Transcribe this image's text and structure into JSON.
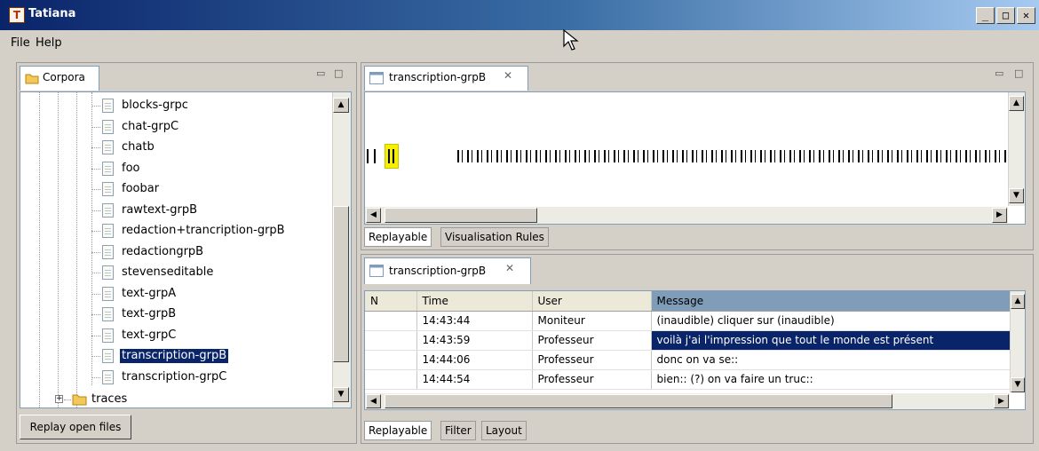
{
  "window": {
    "title": "Tatiana",
    "app_icon": "T",
    "controls": [
      "_",
      "□",
      "✕"
    ]
  },
  "menu": [
    "File",
    "Help"
  ],
  "corpora": {
    "tab_label": "Corpora",
    "items": [
      {
        "label": "blocks-grpc"
      },
      {
        "label": "chat-grpC"
      },
      {
        "label": "chatb"
      },
      {
        "label": "foo"
      },
      {
        "label": "foobar"
      },
      {
        "label": "rawtext-grpB"
      },
      {
        "label": "redaction+trancription-grpB"
      },
      {
        "label": "redactiongrpB"
      },
      {
        "label": "stevenseditable"
      },
      {
        "label": "text-grpA"
      },
      {
        "label": "text-grpB"
      },
      {
        "label": "text-grpC"
      },
      {
        "label": "transcription-grpB",
        "selected": true
      },
      {
        "label": "transcription-grpC"
      }
    ],
    "folder": {
      "expander": "+",
      "label": "traces"
    },
    "replay_button": "Replay open files"
  },
  "timeline_panel": {
    "tab_label": "transcription-grpB",
    "tabs": [
      "Replayable",
      "Visualisation Rules"
    ]
  },
  "table_panel": {
    "tab_label": "transcription-grpB",
    "columns": [
      "N",
      "Time",
      "User",
      "Message"
    ],
    "rows": [
      {
        "n": "",
        "time": "14:43:44",
        "user": "Moniteur",
        "message": "(inaudible) cliquer sur (inaudible)"
      },
      {
        "n": "",
        "time": "14:43:59",
        "user": "Professeur",
        "message": "voilà j'ai l'impression que tout le monde est présent",
        "selected": true
      },
      {
        "n": "",
        "time": "14:44:06",
        "user": "Professeur",
        "message": "donc on va se::"
      },
      {
        "n": "",
        "time": "14:44:54",
        "user": "Professeur",
        "message": "bien:: (?) on va faire un truc::"
      }
    ],
    "tabs": [
      "Replayable",
      "Filter",
      "Layout"
    ]
  },
  "icons": {
    "close_tab": "close-icon",
    "minimize_view": "minimize-icon",
    "maximize_view": "maximize-icon",
    "document": "document-icon",
    "folder": "folder-icon"
  },
  "colors": {
    "title_bar": "#0a246a",
    "selection": "#0a246a",
    "highlight": "#f5f000"
  }
}
